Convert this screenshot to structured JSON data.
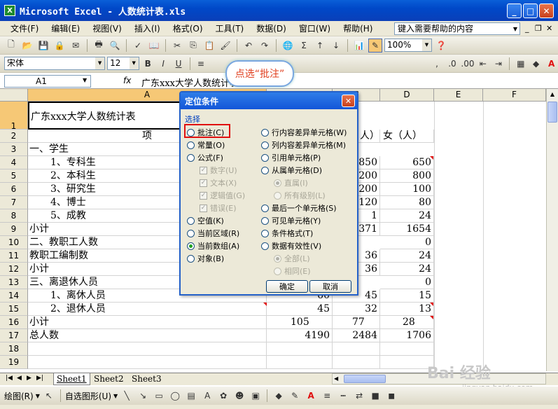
{
  "window": {
    "title": "Microsoft Excel - 人数统计表.xls",
    "app_icon": "X"
  },
  "menu": [
    "文件(F)",
    "编辑(E)",
    "视图(V)",
    "插入(I)",
    "格式(O)",
    "工具(T)",
    "数据(D)",
    "窗口(W)",
    "帮助(H)"
  ],
  "help_box": "键入需要帮助的内容",
  "toolbar": {
    "zoom": "100%",
    "font": "宋体",
    "font_size": "12",
    "bold": "B",
    "italic": "I",
    "underline": "U",
    "sum": "Σ"
  },
  "formula_bar": {
    "name_box": "A1",
    "fx": "fx",
    "content": "广东xxx大学人数统计表"
  },
  "callout": "点选“批注”",
  "columns": [
    "A",
    "B",
    "C",
    "D",
    "E",
    "F"
  ],
  "rows": [
    "1",
    "2",
    "3",
    "4",
    "5",
    "6",
    "7",
    "8",
    "9",
    "10",
    "11",
    "12",
    "13",
    "14",
    "15",
    "16",
    "17",
    "18",
    "19"
  ],
  "cells": {
    "a1": "广东xxx大学人数统计表",
    "a2": "项",
    "c2": "人）",
    "d2": "女（人）",
    "a3": "一、学生",
    "a4": "1、专科生",
    "a5": "2、本科生",
    "a6": "3、研究生",
    "a7": "4、博士",
    "a8": "5、成教",
    "a9": "小计",
    "a10": "二、教职工人数",
    "a11": "教职工编制数",
    "a12": "小计",
    "a13": "三、离退休人员",
    "a14": "1、离休人员",
    "a15": "2、退休人员",
    "a16": "小计",
    "a17": "总人数",
    "c4": "850",
    "d4": "650",
    "c5": "1200",
    "d5": "800",
    "c6": "200",
    "d6": "100",
    "c7": "120",
    "d7": "80",
    "c8": "1",
    "d8": "24",
    "c9": "2371",
    "d9": "1654",
    "d10": "0",
    "c11": "36",
    "d11": "24",
    "c12": "36",
    "d12": "24",
    "d13": "0",
    "b14": "60",
    "c14": "45",
    "d14": "15",
    "b15": "45",
    "c15": "32",
    "d15": "13",
    "b16": "105",
    "c16": "77",
    "d16": "28",
    "b17": "4190",
    "c17": "2484",
    "d17": "1706"
  },
  "dialog": {
    "title": "定位条件",
    "group": "选择",
    "left_options": [
      "批注(C)",
      "常量(O)",
      "公式(F)"
    ],
    "formula_subs": [
      "数字(U)",
      "文本(X)",
      "逻辑值(G)",
      "错误(E)"
    ],
    "left_options2": [
      "空值(K)",
      "当前区域(R)",
      "当前数组(A)",
      "对象(B)"
    ],
    "right_options": [
      "行内容差异单元格(W)",
      "列内容差异单元格(M)",
      "引用单元格(P)",
      "从属单元格(D)"
    ],
    "dep_subs": [
      "直属(I)",
      "所有级别(L)"
    ],
    "right_options2": [
      "最后一个单元格(S)",
      "可见单元格(Y)",
      "条件格式(T)",
      "数据有效性(V)"
    ],
    "valid_subs": [
      "全部(L)",
      "相同(E)"
    ],
    "ok": "确定",
    "cancel": "取消",
    "selected": "当前数组(A)"
  },
  "sheets": [
    "Sheet1",
    "Sheet2",
    "Sheet3"
  ],
  "drawbar": {
    "draw": "绘图(R)",
    "autoshape": "自选图形(U)"
  },
  "watermark": "Bai 经验",
  "watermark_url": "jingyan.baidu.com"
}
